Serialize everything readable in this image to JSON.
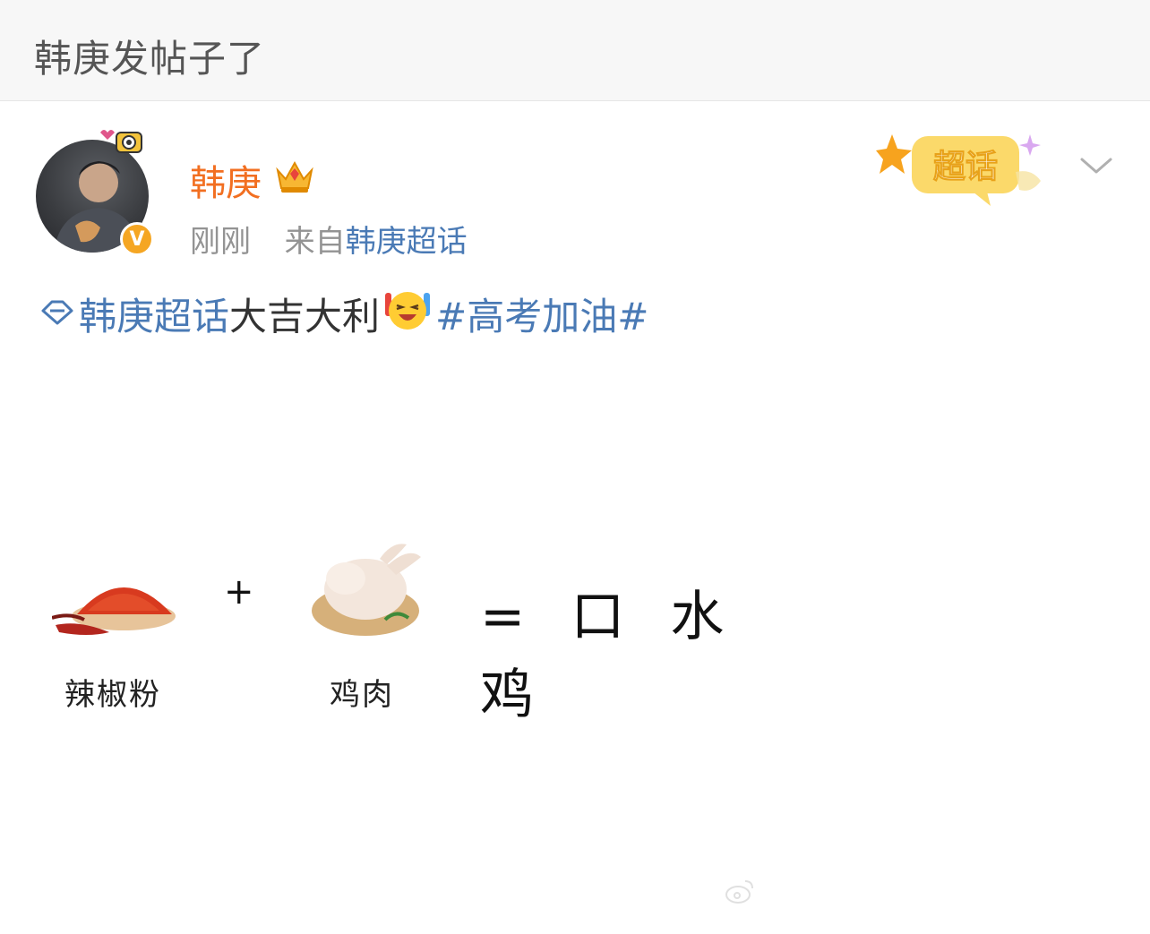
{
  "header": {
    "title": "韩庚发帖子了"
  },
  "post": {
    "author": {
      "name": "韩庚"
    },
    "time": "刚刚",
    "source_prefix": "来自",
    "source_link": "韩庚超话",
    "badge_label": "超话",
    "content": {
      "topic_link": "韩庚超话",
      "text": " 大吉大利",
      "hashtag": "#高考加油#"
    },
    "image": {
      "plus": "+",
      "result": "= 口 水 鸡",
      "ingredient1_label": "辣椒粉",
      "ingredient2_label": "鸡肉"
    }
  },
  "icons": {
    "verified": "V"
  },
  "colors": {
    "username": "#f26f21",
    "link": "#4a7ab5",
    "meta": "#939393",
    "verified_badge": "#f5a623"
  }
}
